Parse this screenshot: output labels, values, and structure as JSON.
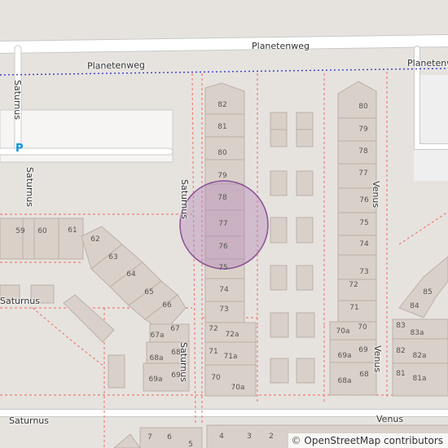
{
  "map": {
    "streets": {
      "planetenweg_top": "Planetenweg",
      "planetenweg_path": "Planetenweg",
      "planetenweg_path_right": "Planetenweg",
      "saturnus_left_vertical": "Saturnus",
      "saturnus_center_vertical": "Saturnus",
      "saturnus_lower_vertical": "Saturnus",
      "saturnus_mid_left": "Saturnus",
      "saturnus_bottom": "Saturnus",
      "venus_right_vertical": "Venus",
      "venus_lower_vertical": "Venus",
      "venus_bottom": "Venus"
    },
    "parking_symbol": "P",
    "house_numbers": {
      "row_left_column": [
        "82",
        "81",
        "80",
        "79",
        "78",
        "77",
        "76",
        "75",
        "74",
        "73",
        "72",
        "72a",
        "71",
        "71a",
        "70",
        "70a"
      ],
      "row_right_column": [
        "80",
        "79",
        "78",
        "77",
        "76",
        "75",
        "74",
        "73",
        "72",
        "71",
        "70",
        "70a",
        "69",
        "69a",
        "68",
        "68a"
      ],
      "left_cluster": [
        "59",
        "60",
        "61",
        "62",
        "63",
        "64",
        "65",
        "66",
        "67",
        "67a",
        "68",
        "68a",
        "69",
        "69a"
      ],
      "far_right_cluster": [
        "85",
        "84",
        "83",
        "83a",
        "82",
        "82a",
        "81",
        "81a"
      ],
      "bottom_row": [
        "7",
        "6",
        "5",
        "4",
        "3",
        "2"
      ]
    },
    "highlight_circle": {
      "fill": "#b58bb7",
      "stroke": "#8a4f94"
    },
    "attribution": {
      "symbol": "©",
      "text": "OpenStreetMap contributors"
    }
  }
}
